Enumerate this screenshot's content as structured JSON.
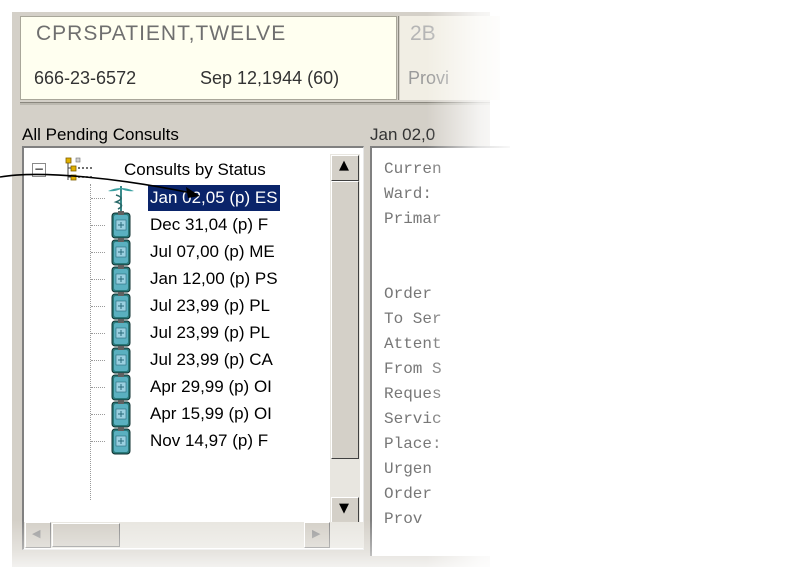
{
  "header": {
    "patient_name": "CPRSPATIENT,TWELVE",
    "ssn": "666-23-6572",
    "dob": "Sep 12,1944 (60)",
    "room": "2B",
    "provider": "Provi"
  },
  "consults_panel": {
    "label": "All Pending Consults",
    "root": "Consults by Status",
    "expander": "−",
    "items": [
      "Jan 02,05  (p)  ES",
      "Dec 31,04  (p)  F",
      "Jul 07,00  (p)  ME",
      "Jan 12,00  (p)  PS",
      "Jul 23,99  (p)  PL",
      "Jul 23,99  (p)  PL",
      "Jul 23,99  (p)  CA",
      "Apr 29,99  (p)  OI",
      "Apr 15,99  (p)  OI",
      "Nov 14,97  (p)  F"
    ],
    "selected_index": 0
  },
  "detail_panel": {
    "label": "Jan 02,0",
    "lines": [
      "Curren",
      "Ward:",
      "Primar",
      "",
      "Order",
      "To Ser",
      "Attent",
      "From S",
      "Reques",
      "Servic",
      "Place:",
      "Urgen",
      "Order",
      "Prov"
    ]
  },
  "scrollbar": {
    "up_glyph": "▲",
    "down_glyph": "▼",
    "left_glyph": "◀",
    "right_glyph": "▶"
  },
  "colors": {
    "selection": "#0a246a",
    "header_bg": "#fffff0",
    "panel_bg": "#d4d0c8"
  },
  "icons": {
    "root": "consult-tree-icon",
    "item": "consult-document-icon",
    "selected_item": "caduceus-icon"
  }
}
